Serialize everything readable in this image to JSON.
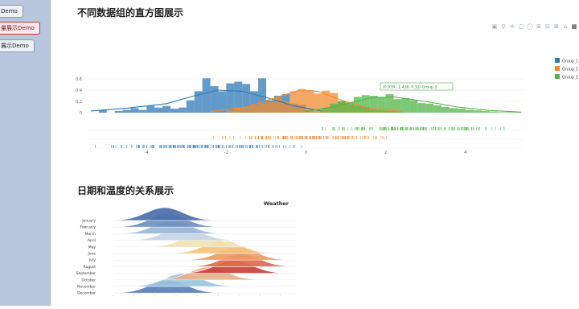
{
  "sidebar": {
    "items": [
      {
        "label": "Demo"
      },
      {
        "label": "量展示Demo"
      },
      {
        "label": "展示Demo"
      }
    ]
  },
  "section1": {
    "title": "不同数据组的直方图展示"
  },
  "section2": {
    "title": "日期和温度的关系展示"
  },
  "modebar": {
    "icons": [
      "camera-icon",
      "zoom-icon",
      "pan-icon",
      "box-select-icon",
      "lasso-icon",
      "zoom-in-icon",
      "zoom-out-icon",
      "autoscale-icon",
      "home-icon",
      "plotly-logo-icon"
    ]
  },
  "chart_data": [
    {
      "type": "histogram",
      "title": "",
      "xlabel": "",
      "ylabel": "",
      "xlim": [
        -5.5,
        5.5
      ],
      "ylim": [
        0,
        1.0
      ],
      "yticks": [
        0,
        0.2,
        0.4,
        0.6
      ],
      "ytick_labels": [
        "0",
        "0.2",
        "0.4",
        "0.6"
      ],
      "xticks": [
        -4,
        -2,
        0,
        2,
        4
      ],
      "legend_position": "top-right",
      "hover_label": "(0.939 , 1.438, 0.32) Group 3",
      "series": [
        {
          "name": "Group 1",
          "color": "#2e78b7",
          "bins": [
            -5.2,
            -5.0,
            -4.8,
            -4.6,
            -4.4,
            -4.2,
            -4.0,
            -3.8,
            -3.6,
            -3.4,
            -3.2,
            -3.0,
            -2.8,
            -2.6,
            -2.4,
            -2.2,
            -2.0,
            -1.8,
            -1.6,
            -1.4,
            -1.2,
            -1.0,
            -0.8,
            -0.6,
            -0.4,
            -0.2,
            0.0,
            0.2
          ],
          "values": [
            0.05,
            0.0,
            0.03,
            0.05,
            0.08,
            0.05,
            0.12,
            0.09,
            0.12,
            0.07,
            0.09,
            0.22,
            0.38,
            0.61,
            0.47,
            0.38,
            0.52,
            0.55,
            0.51,
            0.38,
            0.61,
            0.22,
            0.3,
            0.33,
            0.16,
            0.14,
            0.05,
            0.02
          ],
          "kde": [
            [
              -5.4,
              0.03
            ],
            [
              -4.5,
              0.08
            ],
            [
              -3.5,
              0.16
            ],
            [
              -2.8,
              0.3
            ],
            [
              -2.2,
              0.4
            ],
            [
              -1.6,
              0.38
            ],
            [
              -1.0,
              0.27
            ],
            [
              -0.3,
              0.12
            ],
            [
              0.4,
              0.03
            ]
          ]
        },
        {
          "name": "Group 2",
          "color": "#f08b2e",
          "bins": [
            -2.0,
            -1.8,
            -1.6,
            -1.4,
            -1.2,
            -1.0,
            -0.8,
            -0.6,
            -0.4,
            -0.2,
            0.0,
            0.2,
            0.4,
            0.6,
            0.8,
            1.0,
            1.2,
            1.4,
            1.6,
            1.8,
            2.0,
            2.2
          ],
          "values": [
            0.04,
            0.09,
            0.1,
            0.14,
            0.17,
            0.19,
            0.28,
            0.2,
            0.38,
            0.42,
            0.4,
            0.34,
            0.39,
            0.35,
            0.2,
            0.15,
            0.12,
            0.1,
            0.05,
            0.04,
            0.03,
            0.02
          ],
          "kde": [
            [
              -2.4,
              0.02
            ],
            [
              -1.5,
              0.1
            ],
            [
              -0.8,
              0.26
            ],
            [
              -0.2,
              0.39
            ],
            [
              0.3,
              0.38
            ],
            [
              0.9,
              0.22
            ],
            [
              1.6,
              0.08
            ],
            [
              2.4,
              0.02
            ]
          ]
        },
        {
          "name": "Group 3",
          "color": "#52b547",
          "bins": [
            0.4,
            0.6,
            0.8,
            1.0,
            1.2,
            1.4,
            1.6,
            1.8,
            2.0,
            2.2,
            2.4,
            2.6,
            2.8,
            3.0,
            3.2,
            3.4,
            3.6,
            3.8,
            4.0,
            4.2,
            4.4,
            4.6,
            4.8,
            5.0,
            5.2
          ],
          "values": [
            0.08,
            0.16,
            0.21,
            0.18,
            0.28,
            0.31,
            0.3,
            0.28,
            0.33,
            0.24,
            0.26,
            0.22,
            0.17,
            0.16,
            0.13,
            0.1,
            0.08,
            0.07,
            0.05,
            0.04,
            0.03,
            0.02,
            0.01,
            0.01,
            0.01
          ],
          "kde": [
            [
              0.0,
              0.02
            ],
            [
              0.8,
              0.12
            ],
            [
              1.6,
              0.26
            ],
            [
              2.2,
              0.28
            ],
            [
              3.0,
              0.2
            ],
            [
              3.8,
              0.1
            ],
            [
              4.6,
              0.04
            ],
            [
              5.4,
              0.01
            ]
          ]
        }
      ]
    },
    {
      "type": "ridgeline",
      "title": "Weather",
      "categories": [
        "January",
        "February",
        "March",
        "April",
        "May",
        "June",
        "July",
        "August",
        "September",
        "October",
        "November",
        "December"
      ],
      "colors": [
        "#4b6fa9",
        "#6d8fc0",
        "#9ab8d8",
        "#c3d7e6",
        "#f1e3b2",
        "#f4c27d",
        "#ee9b66",
        "#e06a4e",
        "#cc3f3c",
        "#e9b08a",
        "#9bc3df",
        "#5a7fb6"
      ]
    }
  ]
}
